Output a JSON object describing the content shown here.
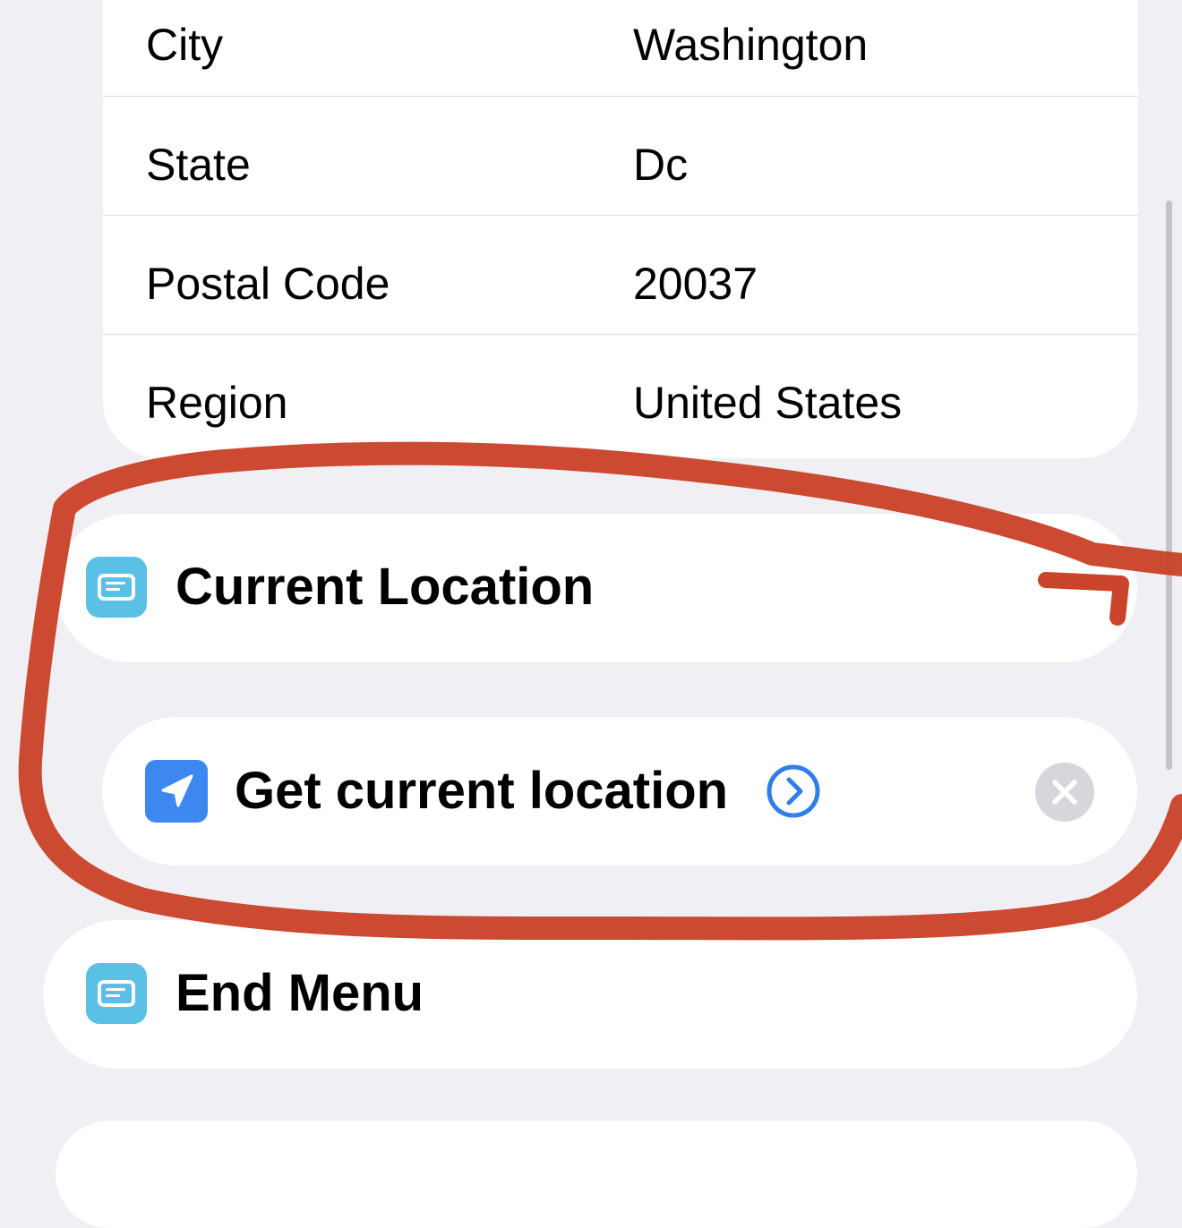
{
  "address_details": [
    {
      "key": "City",
      "value": "Washington"
    },
    {
      "key": "State",
      "value": "Dc"
    },
    {
      "key": "Postal Code",
      "value": "20037"
    },
    {
      "key": "Region",
      "value": "United States"
    }
  ],
  "actions": {
    "current_location": {
      "label": "Current Location",
      "icon": "menu-item-icon"
    },
    "get_location": {
      "label": "Get current location",
      "icon": "location-arrow-icon"
    },
    "end_menu": {
      "label": "End Menu",
      "icon": "menu-item-icon"
    }
  },
  "colors": {
    "background": "#efeff4",
    "menu_icon": "#5ac0e6",
    "location_icon": "#3d88f0",
    "accent": "#2f7fe6",
    "annotation": "#c9442a"
  }
}
